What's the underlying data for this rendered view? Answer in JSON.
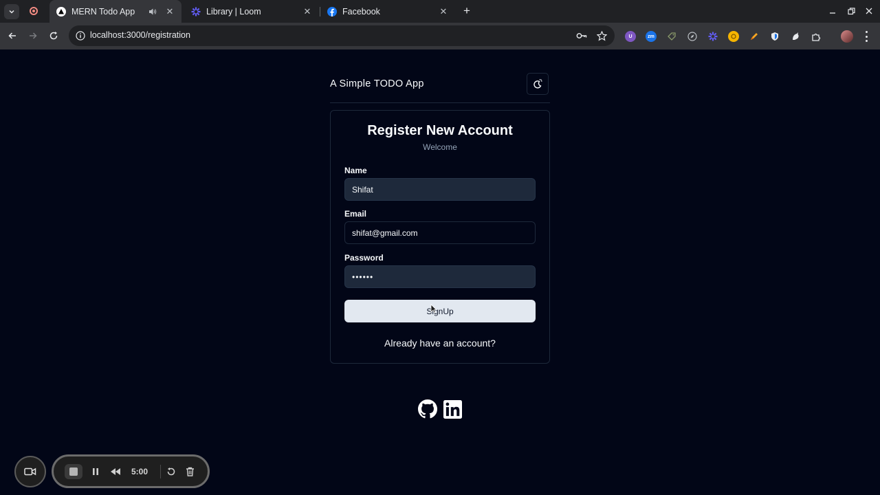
{
  "browser": {
    "tabs": [
      {
        "title": "MERN Todo App",
        "active": true
      },
      {
        "title": "Library | Loom",
        "active": false
      },
      {
        "title": "Facebook",
        "active": false
      }
    ],
    "close_glyph": "✕",
    "new_tab_glyph": "+",
    "url": "localhost:3000/registration",
    "extensions": [
      {
        "icon": "extension-u-icon",
        "text": "U",
        "color": "#7e57c2"
      },
      {
        "icon": "extension-zm-icon",
        "text": "zm",
        "color": "#1a73e8"
      }
    ]
  },
  "page": {
    "brand": "A Simple TODO App",
    "card": {
      "title": "Register New Account",
      "subtitle": "Welcome",
      "name_label": "Name",
      "name_value": "Shifat",
      "email_label": "Email",
      "email_value": "shifat@gmail.com",
      "password_label": "Password",
      "password_value": "••••••",
      "signup_label": "SignUp",
      "login_link": "Already have an account?"
    }
  },
  "loom": {
    "time": "5:00"
  },
  "colors": {
    "background": "#020617",
    "border": "#1e293b",
    "input_filled": "#1e293b",
    "button": "#e2e8f0",
    "muted_text": "#94a3b8"
  }
}
